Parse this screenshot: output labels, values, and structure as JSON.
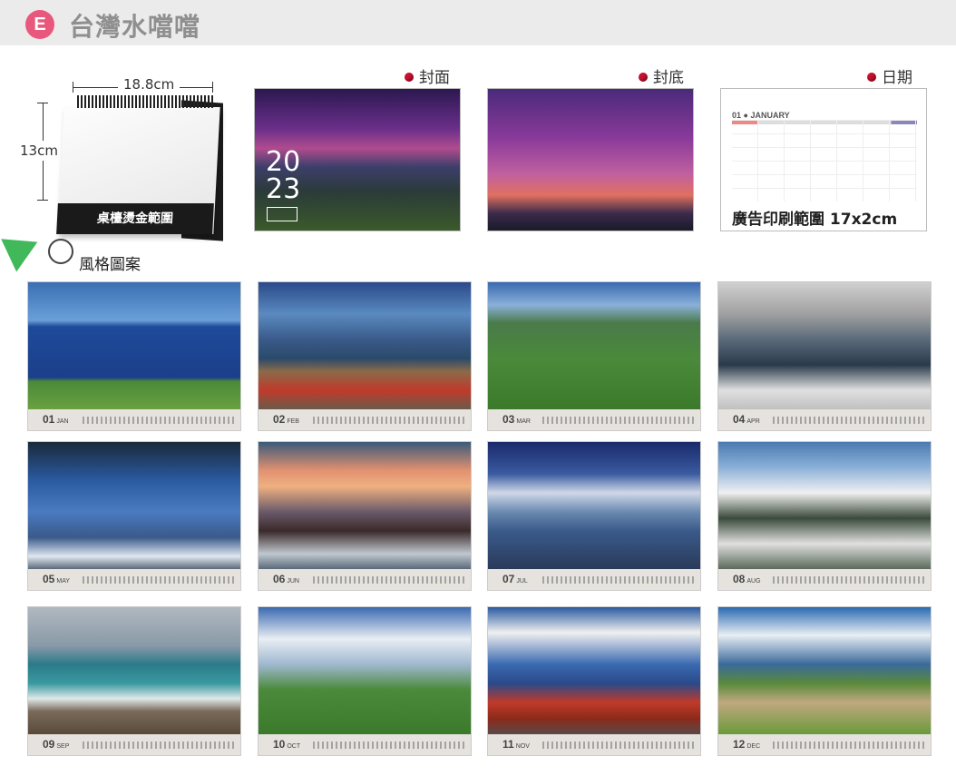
{
  "header": {
    "badge": "E",
    "title": "台灣水噹噹"
  },
  "calendar_model": {
    "width_label": "18.8cm",
    "height_label": "13cm",
    "band_text": "桌檯燙金範圍"
  },
  "labels": {
    "cover": "封面",
    "back": "封底",
    "date": "日期"
  },
  "cover": {
    "year_line1": "20",
    "year_line2": "23"
  },
  "date_page": {
    "month_header": "01 ● JANUARY",
    "ad_text": "廣告印刷範圍 17x2cm"
  },
  "style_section": {
    "label": "風格圖案"
  },
  "months": [
    {
      "num": "01",
      "abbr": "JAN"
    },
    {
      "num": "02",
      "abbr": "FEB"
    },
    {
      "num": "03",
      "abbr": "MAR"
    },
    {
      "num": "04",
      "abbr": "APR"
    },
    {
      "num": "05",
      "abbr": "MAY"
    },
    {
      "num": "06",
      "abbr": "JUN"
    },
    {
      "num": "07",
      "abbr": "JUL"
    },
    {
      "num": "08",
      "abbr": "AUG"
    },
    {
      "num": "09",
      "abbr": "SEP"
    },
    {
      "num": "10",
      "abbr": "OCT"
    },
    {
      "num": "11",
      "abbr": "NOV"
    },
    {
      "num": "12",
      "abbr": "DEC"
    }
  ],
  "colors": {
    "badge": "#e8587d",
    "dot": "#c8102e",
    "arrow": "#41b85a"
  }
}
